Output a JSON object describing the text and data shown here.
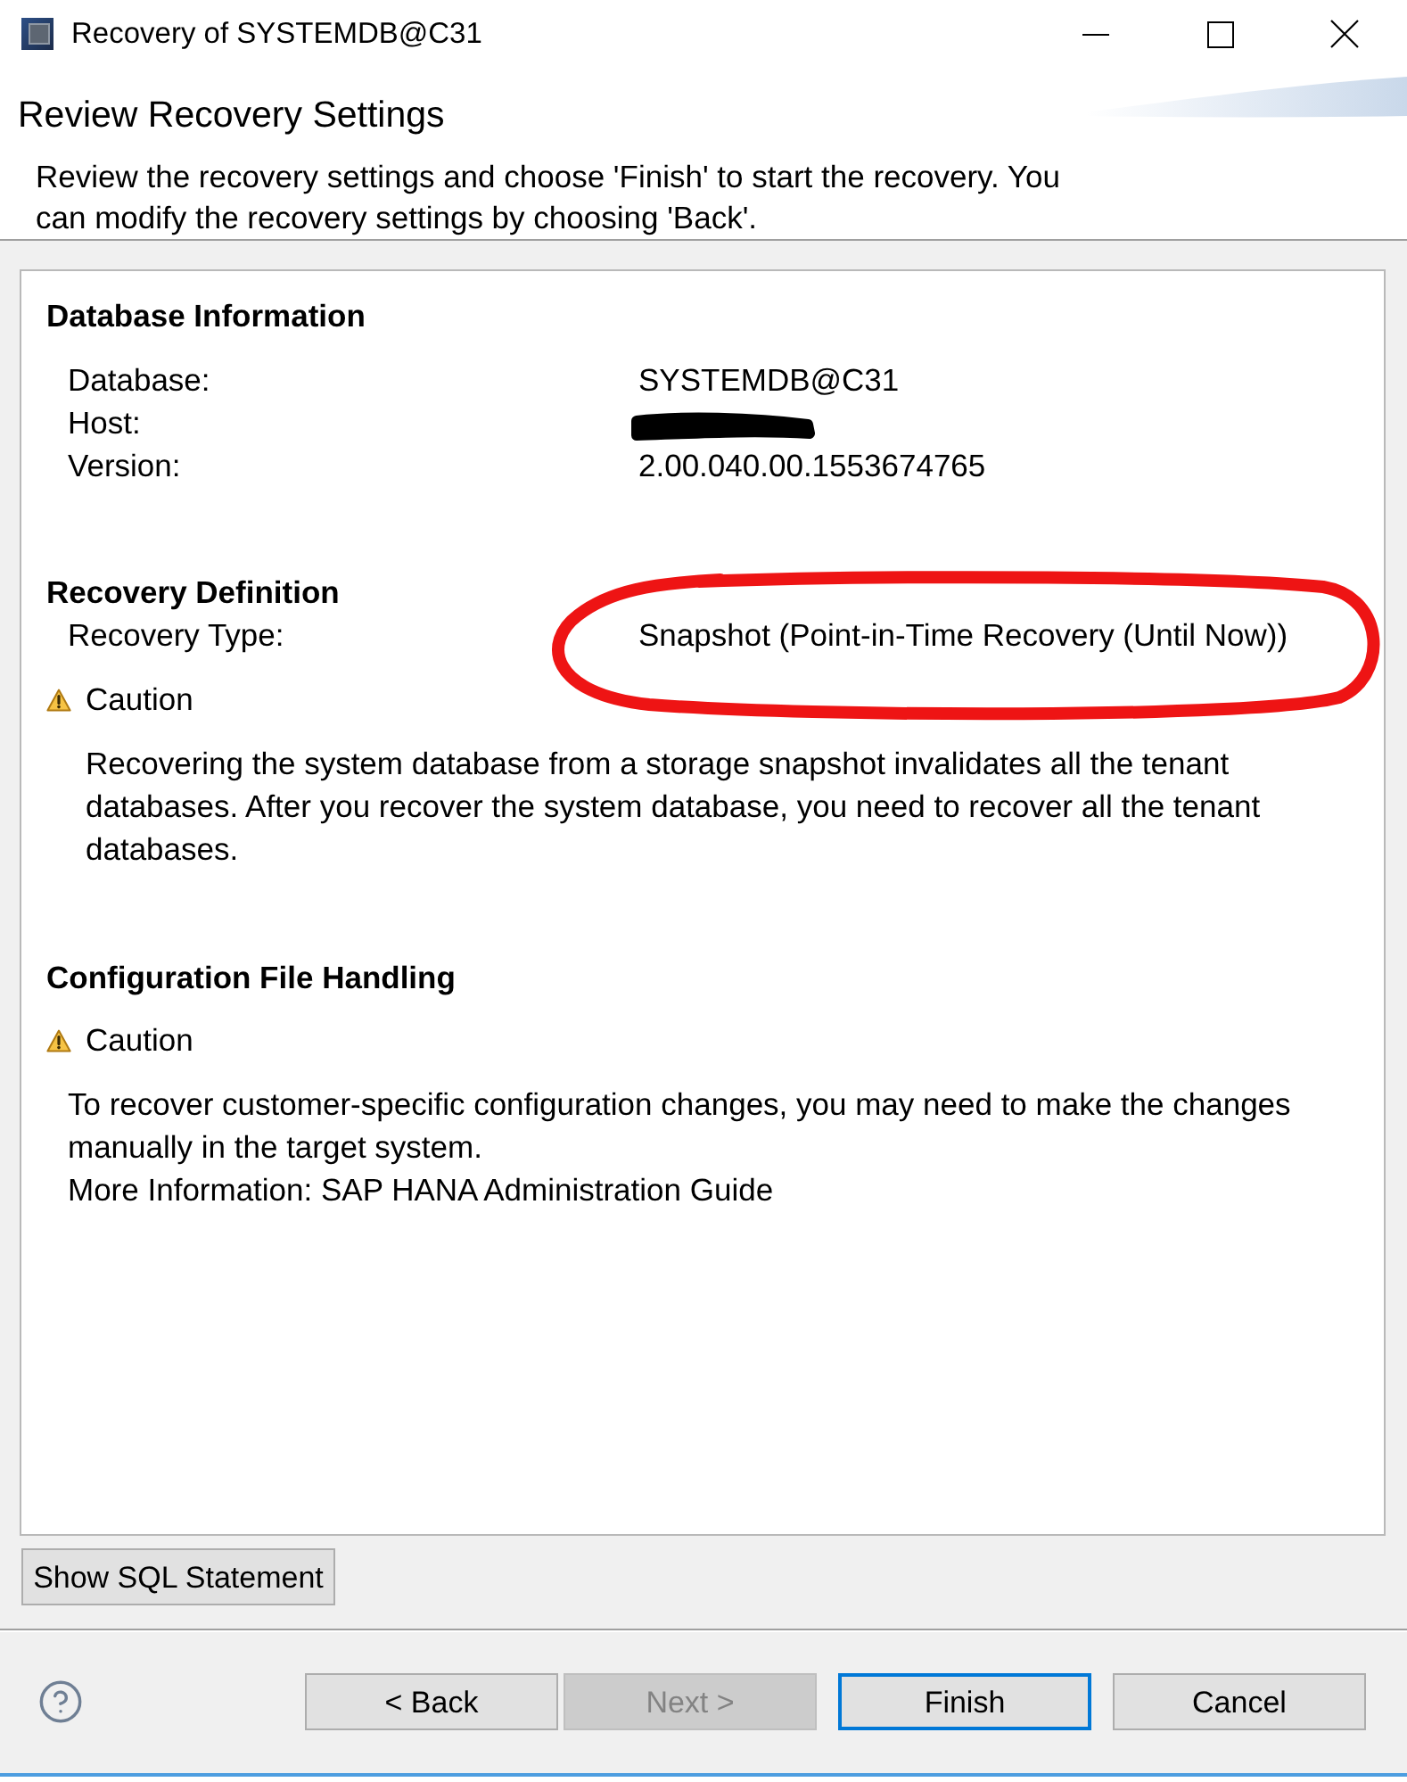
{
  "window": {
    "title": "Recovery of SYSTEMDB@C31"
  },
  "header": {
    "title": "Review Recovery Settings",
    "description": "Review the recovery settings and choose 'Finish' to start the recovery. You can modify the recovery settings by choosing 'Back'."
  },
  "sections": [
    {
      "title": "Database Information",
      "fields": [
        {
          "label": "Database:",
          "value": "SYSTEMDB@C31",
          "redacted": false,
          "circled": false
        },
        {
          "label": "Host:",
          "redacted": true,
          "circled": false
        },
        {
          "label": "Version:",
          "value": "2.00.040.00.1553674765",
          "redacted": false,
          "circled": false
        }
      ]
    },
    {
      "title": "Recovery Definition",
      "fields": [
        {
          "label": "Recovery Type:",
          "value": "Snapshot (Point-in-Time Recovery (Until Now))",
          "redacted": false,
          "circled": true
        }
      ],
      "caution": {
        "title": "Caution",
        "text": "Recovering the system database from a storage snapshot invalidates all the tenant databases. After you recover the system database, you need to recover all the tenant databases."
      }
    },
    {
      "title": "Configuration File Handling",
      "caution": {
        "title": "Caution",
        "text": "To recover customer-specific configuration changes, you may need to make the changes manually in the target system.",
        "note": "More Information: SAP HANA Administration Guide"
      }
    }
  ],
  "show_sql_button": "Show SQL Statement",
  "buttons": [
    {
      "label": "< Back",
      "disabled": false,
      "focused": false
    },
    {
      "label": "Next >",
      "disabled": true,
      "focused": false
    },
    {
      "label": "Finish",
      "disabled": false,
      "focused": true
    },
    {
      "label": "Cancel",
      "disabled": false,
      "focused": false
    }
  ]
}
